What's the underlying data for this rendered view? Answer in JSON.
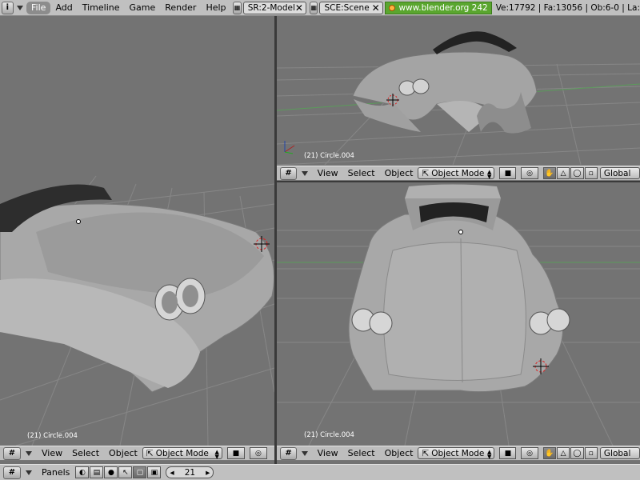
{
  "topbar": {
    "info_icon": "i",
    "menu": [
      "File",
      "Add",
      "Timeline",
      "Game",
      "Render",
      "Help"
    ],
    "screen_field": "SR:2-Model",
    "scene_field": "SCE:Scene",
    "url": "www.blender.org 242",
    "stats": "Ve:17792 | Fa:13056 | Ob:6-0 | La:"
  },
  "viewports": {
    "left": {
      "label": "(21) Circle.004"
    },
    "top_right": {
      "label": "(21) Circle.004"
    },
    "bottom_right": {
      "label": "(21) Circle.004"
    }
  },
  "view_header": {
    "view": "View",
    "select": "Select",
    "object": "Object",
    "mode": "Object Mode",
    "orientation": "Global"
  },
  "bottombar": {
    "panels": "Panels",
    "frame": "21"
  },
  "icons": {
    "grid": "grid-icon",
    "hand": "hand-icon",
    "triangle": "triangle-icon",
    "sphere": "sphere-icon"
  }
}
